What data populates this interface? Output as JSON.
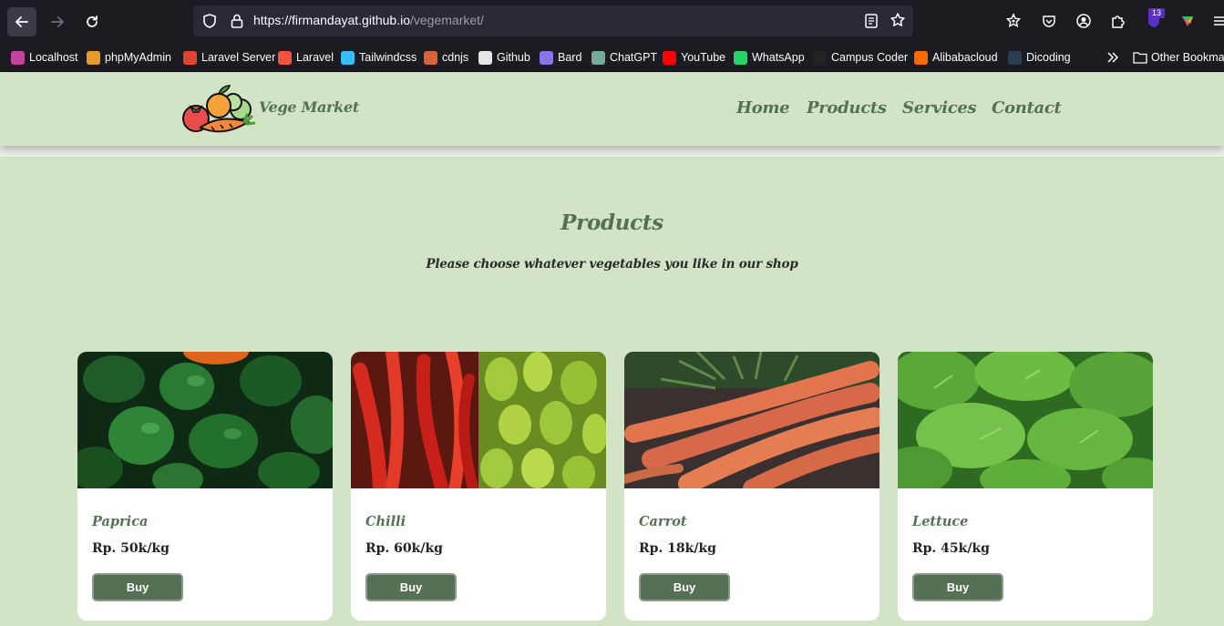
{
  "browser": {
    "url_host": "https://firmandayat.github.io",
    "url_path": "/vegemarket/",
    "extension_badge": "13",
    "bookmarks": [
      {
        "label": "Localhost",
        "color": "#c2459b"
      },
      {
        "label": "phpMyAdmin",
        "color": "#e69a2c"
      },
      {
        "label": "Laravel Server",
        "color": "#e0452d"
      },
      {
        "label": "Laravel",
        "color": "#f0533f"
      },
      {
        "label": "Tailwindcss",
        "color": "#38bdf8"
      },
      {
        "label": "cdnjs",
        "color": "#d9643a"
      },
      {
        "label": "Github",
        "color": "#e6e6e6"
      },
      {
        "label": "Bard",
        "color": "#8b74e8"
      },
      {
        "label": "ChatGPT",
        "color": "#74aa9c"
      },
      {
        "label": "YouTube",
        "color": "#ff0000"
      },
      {
        "label": "WhatsApp",
        "color": "#25d366"
      },
      {
        "label": "Campus Coder",
        "color": "#222222"
      },
      {
        "label": "Alibabacloud",
        "color": "#ff6a00"
      },
      {
        "label": "Dicoding",
        "color": "#2d3e50"
      }
    ],
    "other_bookmarks": "Other Bookmarks"
  },
  "site": {
    "brand": "Vege Market",
    "nav": [
      "Home",
      "Products",
      "Services",
      "Contact"
    ]
  },
  "products_section": {
    "title": "Products",
    "subtitle": "Please choose whatever vegetables you like in our shop"
  },
  "products": [
    {
      "name": "Paprica",
      "price": "Rp. 50k/kg",
      "buy": "Buy",
      "image": "green-peppers-photo"
    },
    {
      "name": "Chilli",
      "price": "Rp. 60k/kg",
      "buy": "Buy",
      "image": "chilli-peppers-photo"
    },
    {
      "name": "Carrot",
      "price": "Rp. 18k/kg",
      "buy": "Buy",
      "image": "carrots-photo"
    },
    {
      "name": "Lettuce",
      "price": "Rp. 45k/kg",
      "buy": "Buy",
      "image": "lettuce-photo"
    }
  ],
  "colors": {
    "page_bg": "#d3e3c6",
    "accent": "#547154",
    "browser_bg": "#1c1b22"
  }
}
